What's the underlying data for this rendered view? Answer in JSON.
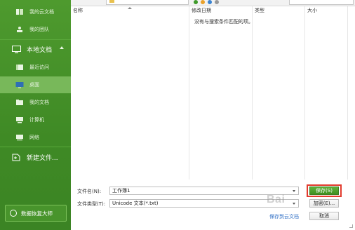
{
  "sidebar": {
    "items": [
      {
        "label": "我的云文档",
        "icon": "cloud-doc-icon"
      },
      {
        "label": "我的团队",
        "icon": "team-icon"
      },
      {
        "label": "本地文档",
        "icon": "local-doc-icon"
      },
      {
        "label": "最近访问",
        "icon": "recent-icon"
      },
      {
        "label": "桌面",
        "icon": "desktop-icon"
      },
      {
        "label": "我的文档",
        "icon": "folder-icon"
      },
      {
        "label": "计算机",
        "icon": "computer-icon"
      },
      {
        "label": "网络",
        "icon": "network-icon"
      },
      {
        "label": "新建文件...",
        "icon": "new-file-icon"
      }
    ],
    "selected": "桌面",
    "recover_button": "数据恢复大师"
  },
  "file_list": {
    "columns": [
      "名称",
      "修改日期",
      "类型",
      "大小"
    ],
    "empty_message": "没有与搜索条件匹配的项。"
  },
  "form": {
    "filename_label": "文件名(N):",
    "filename_value": "工作簿1",
    "filetype_label": "文件类型(T):",
    "filetype_value": "Unicode 文本(*.txt)",
    "save_button": "保存(S)",
    "encrypt_button": "加密(E)...",
    "cancel_button": "取消",
    "backup_link": "保存到云文档"
  },
  "colors": {
    "sidebar": "#4e9a2e",
    "selected": "#78b85a",
    "primary_button": "#4fa32f",
    "highlight": "#e23b2e"
  },
  "watermark": "Bai"
}
